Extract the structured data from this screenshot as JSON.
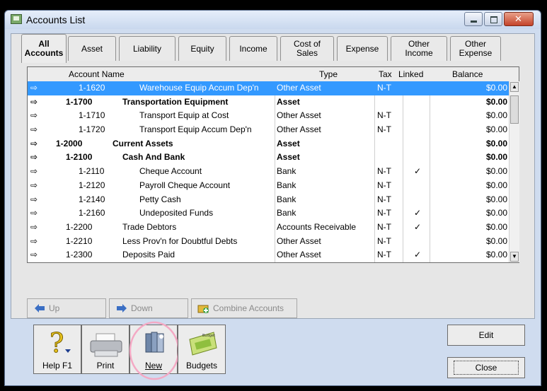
{
  "window": {
    "title": "Accounts List"
  },
  "tabs": [
    {
      "label": "All\nAccounts",
      "active": true
    },
    {
      "label": "Asset"
    },
    {
      "label": "Liability"
    },
    {
      "label": "Equity"
    },
    {
      "label": "Income"
    },
    {
      "label": "Cost of\nSales"
    },
    {
      "label": "Expense"
    },
    {
      "label": "Other\nIncome"
    },
    {
      "label": "Other\nExpense"
    }
  ],
  "table": {
    "columns": {
      "name": "Account Name",
      "type": "Type",
      "tax": "Tax",
      "linked": "Linked",
      "balance": "Balance"
    },
    "rows": [
      {
        "number": "1-1620",
        "name": "Warehouse Equip Accum Dep'n",
        "type": "Other Asset",
        "tax": "N-T",
        "linked": "",
        "balance": "$0.00",
        "level": 3,
        "bold": false,
        "selected": true
      },
      {
        "number": "1-1700",
        "name": "Transportation Equipment",
        "type": "Asset",
        "tax": "",
        "linked": "",
        "balance": "$0.00",
        "level": 2,
        "bold": true
      },
      {
        "number": "1-1710",
        "name": "Transport Equip at Cost",
        "type": "Other Asset",
        "tax": "N-T",
        "linked": "",
        "balance": "$0.00",
        "level": 3,
        "bold": false
      },
      {
        "number": "1-1720",
        "name": "Transport Equip Accum Dep'n",
        "type": "Other Asset",
        "tax": "N-T",
        "linked": "",
        "balance": "$0.00",
        "level": 3,
        "bold": false
      },
      {
        "number": "1-2000",
        "name": "Current Assets",
        "type": "Asset",
        "tax": "",
        "linked": "",
        "balance": "$0.00",
        "level": 1,
        "bold": true
      },
      {
        "number": "1-2100",
        "name": "Cash And Bank",
        "type": "Asset",
        "tax": "",
        "linked": "",
        "balance": "$0.00",
        "level": 2,
        "bold": true
      },
      {
        "number": "1-2110",
        "name": "Cheque Account",
        "type": "Bank",
        "tax": "N-T",
        "linked": "✓",
        "balance": "$0.00",
        "level": 3,
        "bold": false
      },
      {
        "number": "1-2120",
        "name": "Payroll Cheque Account",
        "type": "Bank",
        "tax": "N-T",
        "linked": "",
        "balance": "$0.00",
        "level": 3,
        "bold": false
      },
      {
        "number": "1-2140",
        "name": "Petty Cash",
        "type": "Bank",
        "tax": "N-T",
        "linked": "",
        "balance": "$0.00",
        "level": 3,
        "bold": false
      },
      {
        "number": "1-2160",
        "name": "Undeposited Funds",
        "type": "Bank",
        "tax": "N-T",
        "linked": "✓",
        "balance": "$0.00",
        "level": 3,
        "bold": false
      },
      {
        "number": "1-2200",
        "name": "Trade Debtors",
        "type": "Accounts Receivable",
        "tax": "N-T",
        "linked": "✓",
        "balance": "$0.00",
        "level": 2,
        "bold": false
      },
      {
        "number": "1-2210",
        "name": "Less Prov'n for Doubtful Debts",
        "type": "Other Asset",
        "tax": "N-T",
        "linked": "",
        "balance": "$0.00",
        "level": 2,
        "bold": false
      },
      {
        "number": "1-2300",
        "name": "Deposits Paid",
        "type": "Other Asset",
        "tax": "N-T",
        "linked": "✓",
        "balance": "$0.00",
        "level": 2,
        "bold": false
      }
    ]
  },
  "actions": {
    "up": "Up",
    "down": "Down",
    "combine": "Combine Accounts"
  },
  "toolbar": {
    "help": "Help F1",
    "print": "Print",
    "new": "New",
    "budgets": "Budgets",
    "budget_badge": "Budget"
  },
  "buttons": {
    "edit": "Edit",
    "close": "Close"
  },
  "colors": {
    "selection": "#3399ff",
    "window_bg": "#cfdcef",
    "highlight_circle": "#f4a9c4"
  },
  "icons": {
    "row": "arrow-right-icon",
    "up": "arrow-up-icon",
    "down": "arrow-down-icon",
    "combine": "folder-plus-icon",
    "help": "question-mark-icon",
    "print": "printer-icon",
    "new": "new-document-icon",
    "budgets": "budget-icon"
  }
}
